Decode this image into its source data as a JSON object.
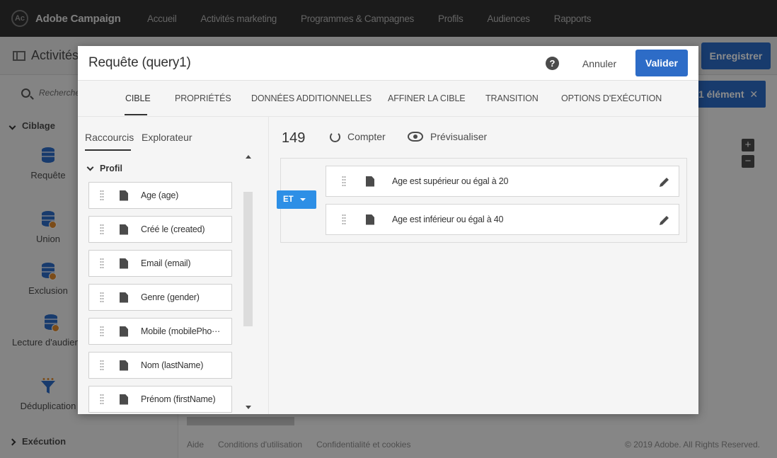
{
  "app": {
    "brand": "Adobe Campaign",
    "nav": [
      "Accueil",
      "Activités marketing",
      "Programmes & Campagnes",
      "Profils",
      "Audiences",
      "Rapports"
    ]
  },
  "background": {
    "page_title": "Activités",
    "save_button": "Enregistrer",
    "search_placeholder": "Recherche...",
    "section_ciblage": "Ciblage",
    "palette": [
      "Requête",
      "Union",
      "Exclusion",
      "Lecture d'audience",
      "Déduplication"
    ],
    "section_execution": "Exécution",
    "selection_chip": "1 élément",
    "footer": {
      "links": [
        "Aide",
        "Conditions d'utilisation",
        "Confidentialité et cookies"
      ],
      "copyright": "© 2019 Adobe. All Rights Reserved."
    }
  },
  "modal": {
    "title": "Requête (query1)",
    "help": "?",
    "cancel": "Annuler",
    "validate": "Valider",
    "tabs": [
      "CIBLE",
      "PROPRIÉTÉS",
      "DONNÉES ADDITIONNELLES",
      "AFFINER LA CIBLE",
      "TRANSITION",
      "OPTIONS D'EXÉCUTION"
    ],
    "active_tab": "CIBLE",
    "left": {
      "subtabs": [
        "Raccourcis",
        "Explorateur"
      ],
      "section": "Profil",
      "fields": [
        "Age (age)",
        "Créé le (created)",
        "Email (email)",
        "Genre (gender)",
        "Mobile (mobilePho···",
        "Nom (lastName)",
        "Prénom (firstName)"
      ]
    },
    "right": {
      "count": "149",
      "count_button": "Compter",
      "preview_button": "Prévisualiser",
      "operator": "ET",
      "rules": [
        "Age est supérieur ou égal à 20",
        "Age est inférieur ou égal à 40"
      ]
    }
  }
}
